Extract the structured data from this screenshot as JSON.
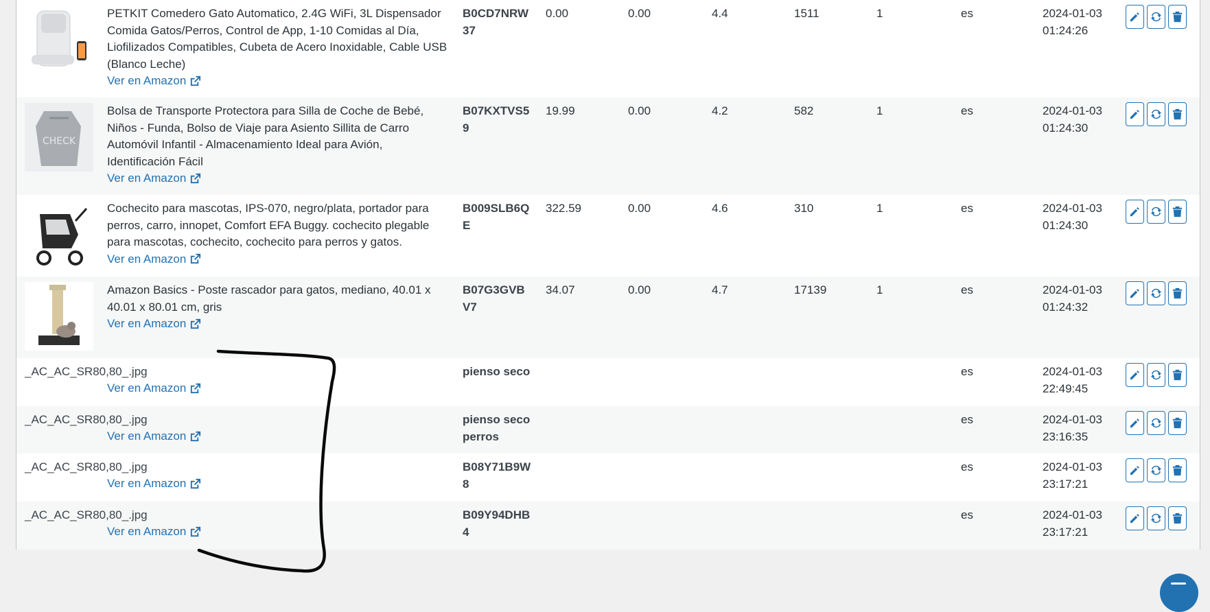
{
  "link_label": "Ver en Amazon",
  "rows": [
    {
      "title": "PETKIT Comedero Gato Automatico, 2.4G WiFi, 3L Dispensador Comida Gatos/Perros, Control de App, 1-10 Comidas al Día, Liofilizados Compatibles, Cubeta de Acero Inoxidable, Cable USB (Blanco Leche)",
      "asin": "B0CD7NRW37",
      "price": "0.00",
      "price2": "0.00",
      "rating": "4.4",
      "reviews": "1511",
      "qty": "1",
      "lang": "es",
      "date": "2024-01-03",
      "time": "01:24:26",
      "image": "feeder"
    },
    {
      "title": "Bolsa de Transporte Protectora para Silla de Coche de Bebé, Niños - Funda, Bolso de Viaje para Asiento Sillita de Carro Automóvil Infantil - Almacenamiento Ideal para Avión, Identificación Fácil",
      "asin": "B07KXTVS59",
      "price": "19.99",
      "price2": "0.00",
      "rating": "4.2",
      "reviews": "582",
      "qty": "1",
      "lang": "es",
      "date": "2024-01-03",
      "time": "01:24:30",
      "image": "bag"
    },
    {
      "title": "Cochecito para mascotas, IPS-070, negro/plata, portador para perros, carro, innopet, Comfort EFA Buggy. cochecito plegable para mascotas, cochecito, cochecito para perros y gatos.",
      "asin": "B009SLB6QE",
      "price": "322.59",
      "price2": "0.00",
      "rating": "4.6",
      "reviews": "310",
      "qty": "1",
      "lang": "es",
      "date": "2024-01-03",
      "time": "01:24:30",
      "image": "stroller"
    },
    {
      "title": "Amazon Basics - Poste rascador para gatos, mediano, 40.01 x 40.01 x 80.01 cm, gris",
      "asin": "B07G3GVBV7",
      "price": "34.07",
      "price2": "0.00",
      "rating": "4.7",
      "reviews": "17139",
      "qty": "1",
      "lang": "es",
      "date": "2024-01-03",
      "time": "01:24:32",
      "image": "scratcher"
    },
    {
      "title": "",
      "broken_image_alt": "_AC_AC_SR80,80_.jpg",
      "asin": "pienso seco",
      "lang": "es",
      "date": "2024-01-03",
      "time": "22:49:45"
    },
    {
      "title": "",
      "broken_image_alt": "_AC_AC_SR80,80_.jpg",
      "asin": "pienso seco perros",
      "lang": "es",
      "date": "2024-01-03",
      "time": "23:16:35"
    },
    {
      "title": "",
      "broken_image_alt": "_AC_AC_SR80,80_.jpg",
      "asin": "B08Y71B9W8",
      "lang": "es",
      "date": "2024-01-03",
      "time": "23:17:21"
    },
    {
      "title": "",
      "broken_image_alt": "_AC_AC_SR80,80_.jpg",
      "asin": "B09Y94DHB4",
      "lang": "es",
      "date": "2024-01-03",
      "time": "23:17:21"
    }
  ],
  "actions": {
    "edit_icon": "pencil-icon",
    "refresh_icon": "refresh-icon",
    "delete_icon": "trash-icon"
  },
  "colors": {
    "link": "#2271b1",
    "alt_row": "#f6f7f7",
    "border": "#c3c4c7"
  }
}
